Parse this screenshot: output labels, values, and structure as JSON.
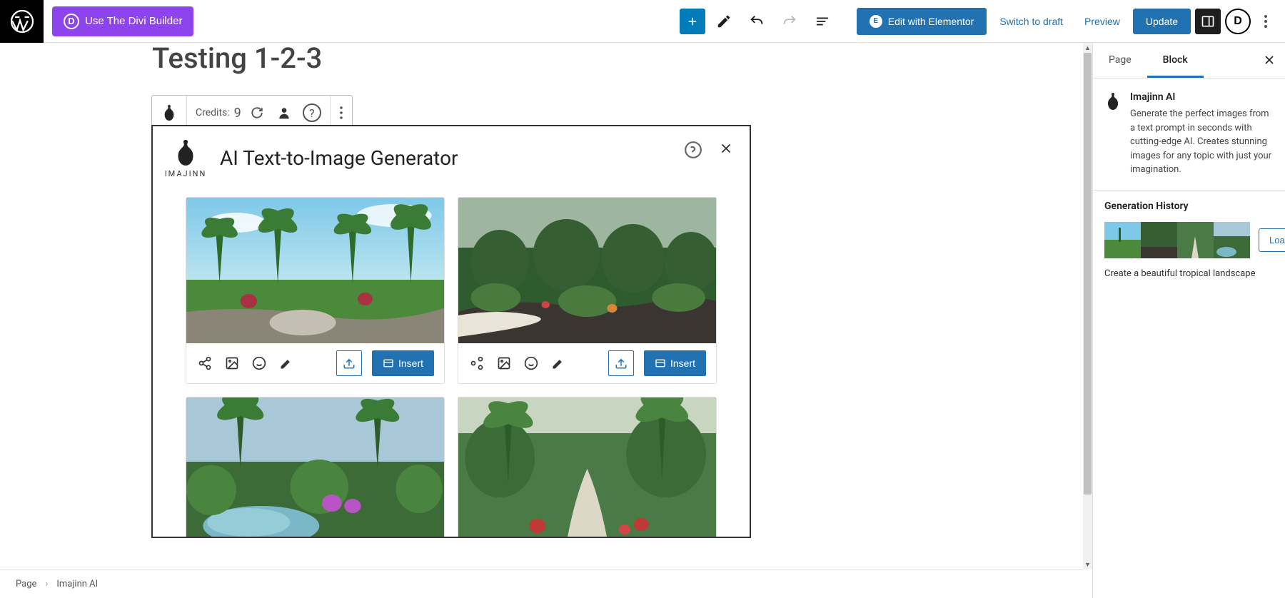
{
  "topbar": {
    "divi_label": "Use The Divi Builder",
    "elementor_label": "Edit with Elementor",
    "switch_draft": "Switch to draft",
    "preview": "Preview",
    "update": "Update"
  },
  "page_title": "Testing 1-2-3",
  "toolbar": {
    "credits_label": "Credits:",
    "credits_value": "9"
  },
  "panel": {
    "logo_text": "IMAJINN",
    "title": "AI Text-to-Image Generator",
    "insert_label": "Insert"
  },
  "sidebar": {
    "tabs": {
      "page": "Page",
      "block": "Block"
    },
    "block_title": "Imajinn AI",
    "block_desc": "Generate the perfect images from a text prompt in seconds with cutting-edge AI. Creates stunning images for any topic with just your imagination.",
    "history_title": "Generation History",
    "load_label": "Load",
    "history_prompt": "Create a beautiful tropical landscape"
  },
  "breadcrumb": {
    "root": "Page",
    "current": "Imajinn AI"
  }
}
